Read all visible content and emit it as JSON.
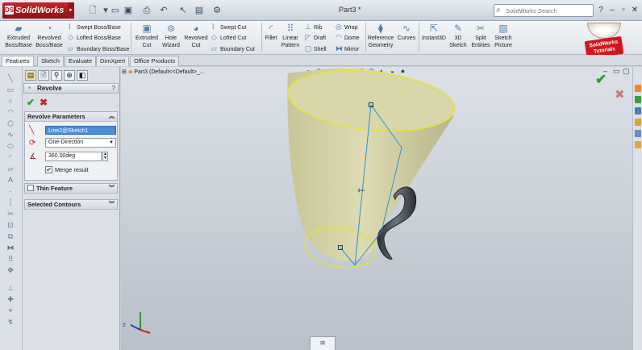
{
  "app": {
    "name": "SolidWorks",
    "document_title": "Part3 *",
    "search_placeholder": "SolidWorks Search"
  },
  "toolbar": {
    "large_tools": [
      {
        "label_1": "Extruded",
        "label_2": "Boss/Base",
        "icon": "extrude-icon"
      },
      {
        "label_1": "Revolved",
        "label_2": "Boss/Base",
        "icon": "revolve-icon"
      },
      {
        "label_1": "Extruded",
        "label_2": "Cut",
        "icon": "extrude-cut-icon"
      },
      {
        "label_1": "Hole",
        "label_2": "Wizard",
        "icon": "hole-wizard-icon"
      },
      {
        "label_1": "Revolved",
        "label_2": "Cut",
        "icon": "revolve-cut-icon"
      },
      {
        "label_1": "Fillet",
        "label_2": "",
        "icon": "fillet-icon"
      },
      {
        "label_1": "Linear",
        "label_2": "Pattern",
        "icon": "linear-pattern-icon"
      },
      {
        "label_1": "Reference",
        "label_2": "Geometry",
        "icon": "reference-geometry-icon"
      },
      {
        "label_1": "Curves",
        "label_2": "",
        "icon": "curves-icon"
      },
      {
        "label_1": "Instant3D",
        "label_2": "",
        "icon": "instant3d-icon"
      },
      {
        "label_1": "3D",
        "label_2": "Sketch",
        "icon": "3d-sketch-icon"
      },
      {
        "label_1": "Split",
        "label_2": "Entities",
        "icon": "split-entities-icon"
      },
      {
        "label_1": "Sketch",
        "label_2": "Picture",
        "icon": "sketch-picture-icon"
      }
    ],
    "small_tools": [
      {
        "label": "Swept Boss/Base"
      },
      {
        "label": "Lofted Boss/Base"
      },
      {
        "label": "Boundary Boss/Base"
      },
      {
        "label": "Swept Cut"
      },
      {
        "label": "Lofted Cut"
      },
      {
        "label": "Boundary Cut"
      },
      {
        "label": "Rib"
      },
      {
        "label": "Draft"
      },
      {
        "label": "Shell"
      },
      {
        "label": "Wrap"
      },
      {
        "label": "Dome"
      },
      {
        "label": "Mirror"
      }
    ],
    "tutorial_badge": "SolidWorks Tutorials"
  },
  "tabs": [
    {
      "label": "Features"
    },
    {
      "label": "Sketch"
    },
    {
      "label": "Evaluate"
    },
    {
      "label": "DimXpert"
    },
    {
      "label": "Office Products"
    }
  ],
  "property_manager": {
    "title": "Revolve",
    "help": "?",
    "sections": {
      "revolve_parameters": {
        "title": "Revolve Parameters",
        "axis_value": "Line2@Sketch1",
        "direction": "One-Direction",
        "angle": "360.00deg",
        "merge_result_label": "Merge result",
        "merge_result_checked": true
      },
      "thin_feature": {
        "title": "Thin Feature"
      },
      "selected_contours": {
        "title": "Selected Contours"
      }
    }
  },
  "feature_tree": {
    "root": "Part3  (Default<<Default>_..."
  },
  "colors": {
    "model_fill": "#d8d5a8",
    "model_edge": "#e4e332",
    "sketch_line": "#2f8fd0",
    "accent_ok": "#2e9b2a",
    "titlebar": "#c9d1dc"
  }
}
